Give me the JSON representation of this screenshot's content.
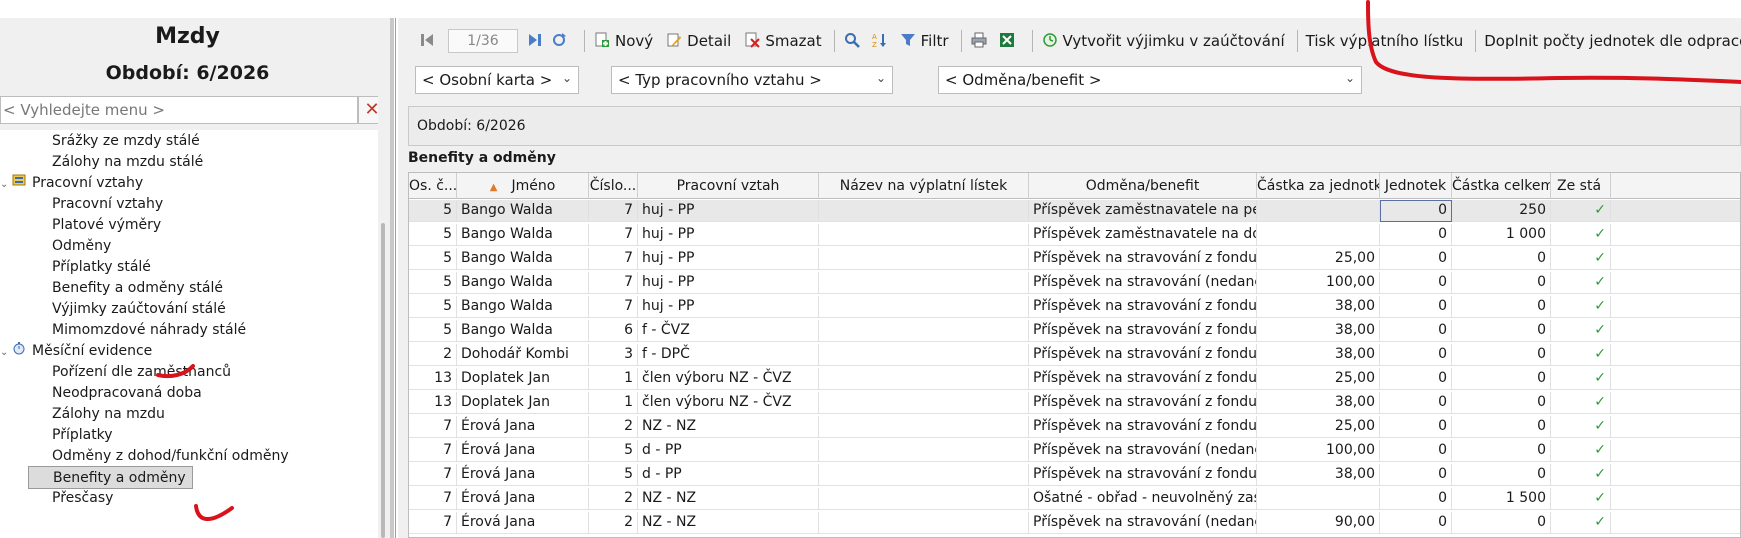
{
  "left": {
    "title": "Mzdy",
    "period": "Období: 6/2026",
    "search_placeholder": "< Vyhledejte menu >",
    "menu": [
      {
        "label": "Srážky ze mzdy stálé"
      },
      {
        "label": "Zálohy na mzdu stálé"
      },
      {
        "label": "Pracovní vztahy"
      },
      {
        "label": "Pracovní vztahy"
      },
      {
        "label": "Platové výměry"
      },
      {
        "label": "Odměny"
      },
      {
        "label": "Příplatky stálé"
      },
      {
        "label": "Benefity a odměny stálé"
      },
      {
        "label": "Výjimky zaúčtování stálé"
      },
      {
        "label": "Mimomzdové náhrady stálé"
      },
      {
        "label": "Měsíční evidence"
      },
      {
        "label": "Pořízení dle zaměstnanců"
      },
      {
        "label": "Neodpracovaná doba"
      },
      {
        "label": "Zálohy na mzdu"
      },
      {
        "label": "Příplatky"
      },
      {
        "label": "Odměny z dohod/funkční odměny"
      },
      {
        "label": "Benefity a odměny"
      },
      {
        "label": "Přesčasy"
      }
    ]
  },
  "toolbar": {
    "pager": "1/36",
    "new": "Nový",
    "detail": "Detail",
    "delete": "Smazat",
    "filter": "Filtr",
    "create_exception": "Vytvořit výjimku v zaúčtování",
    "print_payslip": "Tisk výplatního lístku",
    "fill_units": "Doplnit počty jednotek dle odpracované doby"
  },
  "filters": {
    "personal_card": "< Osobní karta >",
    "relation_type": "< Typ pracovního vztahu >",
    "reward": "< Odměna/benefit >"
  },
  "period_box": "Období: 6/2026",
  "section_title": "Benefity a odměny",
  "table": {
    "columns": [
      "Os. č...",
      "Jméno",
      "Číslo...",
      "Pracovní vztah",
      "Název na výplatní lístek",
      "Odměna/benefit",
      "Částka za jednotku",
      "Jednotek",
      "Částka celkem",
      "Ze stá"
    ],
    "rows": [
      [
        "5",
        "Bango Walda",
        "7",
        "huj - PP",
        "",
        "Příspěvek zaměstnavatele na penzijní",
        "",
        "0",
        "250",
        "✓"
      ],
      [
        "5",
        "Bango Walda",
        "7",
        "huj - PP",
        "",
        "Příspěvek zaměstnavatele na doplňko",
        "",
        "0",
        "1 000",
        "✓"
      ],
      [
        "5",
        "Bango Walda",
        "7",
        "huj - PP",
        "",
        "Příspěvek na stravování z fondu (neda",
        "25,00",
        "0",
        "0",
        "✓"
      ],
      [
        "5",
        "Bango Walda",
        "7",
        "huj - PP",
        "",
        "Příspěvek na stravování (nedaněno)",
        "100,00",
        "0",
        "0",
        "✓"
      ],
      [
        "5",
        "Bango Walda",
        "7",
        "huj - PP",
        "",
        "Příspěvek na stravování z fondu (neda",
        "38,00",
        "0",
        "0",
        "✓"
      ],
      [
        "5",
        "Bango Walda",
        "6",
        "f - ČVZ",
        "",
        "Příspěvek na stravování z fondu (neda",
        "38,00",
        "0",
        "0",
        "✓"
      ],
      [
        "2",
        "Dohodář Kombi",
        "3",
        "f - DPČ",
        "",
        "Příspěvek na stravování z fondu (neda",
        "38,00",
        "0",
        "0",
        "✓"
      ],
      [
        "13",
        "Doplatek Jan",
        "1",
        "člen výboru NZ - ČVZ",
        "",
        "Příspěvek na stravování z fondu (neda",
        "25,00",
        "0",
        "0",
        "✓"
      ],
      [
        "13",
        "Doplatek Jan",
        "1",
        "člen výboru NZ - ČVZ",
        "",
        "Příspěvek na stravování z fondu (neda",
        "38,00",
        "0",
        "0",
        "✓"
      ],
      [
        "7",
        "Érová Jana",
        "2",
        "NZ - NZ",
        "",
        "Příspěvek na stravování z fondu (neda",
        "25,00",
        "0",
        "0",
        "✓"
      ],
      [
        "7",
        "Érová Jana",
        "5",
        "d - PP",
        "",
        "Příspěvek na stravování (nedaněno)",
        "100,00",
        "0",
        "0",
        "✓"
      ],
      [
        "7",
        "Érová Jana",
        "5",
        "d - PP",
        "",
        "Příspěvek na stravování z fondu (neda",
        "38,00",
        "0",
        "0",
        "✓"
      ],
      [
        "7",
        "Érová Jana",
        "2",
        "NZ - NZ",
        "",
        "Ošatné - obřad - neuvolněný zastupit",
        "",
        "0",
        "1 500",
        "✓"
      ],
      [
        "7",
        "Érová Jana",
        "2",
        "NZ - NZ",
        "",
        "Příspěvek na stravování (nedaněno)",
        "90,00",
        "0",
        "0",
        "✓"
      ]
    ]
  },
  "colors": {
    "annotation": "#d8131b",
    "check": "#2e9a3a",
    "panel_bg": "#f0f0f0",
    "selection": "#dcdcdc"
  },
  "icons": {
    "first": "first-page-icon",
    "last": "last-page-icon",
    "refresh": "refresh-icon",
    "new": "new-record-icon",
    "detail": "edit-icon",
    "delete": "delete-icon",
    "search": "search-icon",
    "sort": "sort-icon",
    "filter": "filter-icon",
    "print": "print-icon",
    "excel": "excel-icon",
    "exception": "exception-icon"
  }
}
